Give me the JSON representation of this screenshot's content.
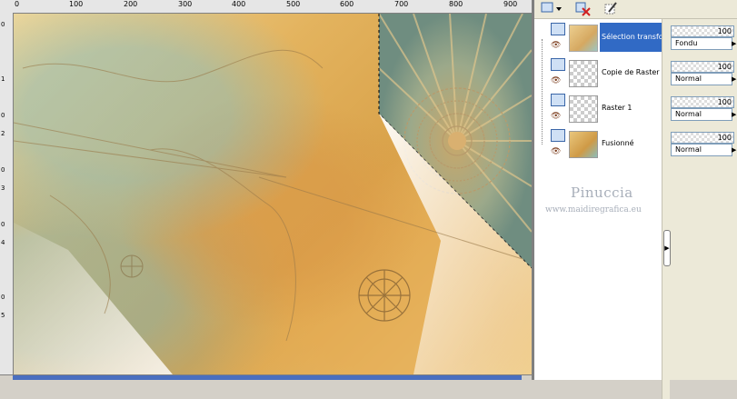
{
  "ruler": {
    "h_ticks": [
      "0",
      "100",
      "200",
      "300",
      "400",
      "500",
      "600",
      "700",
      "800",
      "900"
    ],
    "v_ticks": [
      "0",
      "1",
      "0",
      "2",
      "0",
      "3",
      "0",
      "4",
      "0",
      "5"
    ]
  },
  "layers": [
    {
      "name": "Sélection transfo",
      "selected": true,
      "thumb": "map-transparent"
    },
    {
      "name": "Copie de Raster",
      "selected": false,
      "thumb": "transparent"
    },
    {
      "name": "Raster 1",
      "selected": false,
      "thumb": "transparent"
    },
    {
      "name": "Fusionné",
      "selected": false,
      "thumb": "map"
    }
  ],
  "properties": [
    {
      "opacity": "100",
      "blend": "Fondu"
    },
    {
      "opacity": "100",
      "blend": "Normal"
    },
    {
      "opacity": "100",
      "blend": "Normal"
    },
    {
      "opacity": "100",
      "blend": "Normal"
    }
  ],
  "watermark": {
    "name": "Pinuccia",
    "url": "www.maidiregrafica.eu"
  },
  "colors": {
    "selection": "#316ac5",
    "panel": "#ece9d8"
  }
}
